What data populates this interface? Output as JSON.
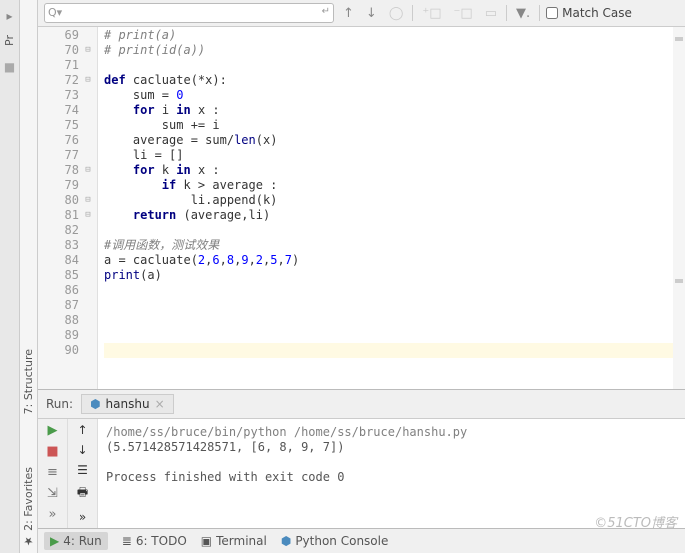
{
  "search": {
    "value": "",
    "placeholder": ""
  },
  "match_case_label": "Match Case",
  "side_tabs": {
    "project": "Pr",
    "structure": "7: Structure",
    "favorites": "2: Favorites"
  },
  "gutter": {
    "start": 69,
    "end": 90
  },
  "code_lines": [
    {
      "n": 69,
      "indent": 0,
      "segs": [
        {
          "t": "# print(a)",
          "c": "cm"
        }
      ]
    },
    {
      "n": 70,
      "indent": 0,
      "segs": [
        {
          "t": "# print(id(a))",
          "c": "cm"
        }
      ],
      "fold": "-"
    },
    {
      "n": 71,
      "indent": 0,
      "segs": []
    },
    {
      "n": 72,
      "indent": 0,
      "segs": [
        {
          "t": "def ",
          "c": "kw"
        },
        {
          "t": "cacluate(*x):",
          "c": ""
        }
      ],
      "fold": "-"
    },
    {
      "n": 73,
      "indent": 1,
      "segs": [
        {
          "t": "sum = ",
          "c": ""
        },
        {
          "t": "0",
          "c": "num"
        }
      ]
    },
    {
      "n": 74,
      "indent": 1,
      "segs": [
        {
          "t": "for ",
          "c": "kw"
        },
        {
          "t": "i ",
          "c": ""
        },
        {
          "t": "in ",
          "c": "kw"
        },
        {
          "t": "x :",
          "c": ""
        }
      ]
    },
    {
      "n": 75,
      "indent": 2,
      "segs": [
        {
          "t": "sum += i",
          "c": ""
        }
      ],
      "arrow": true
    },
    {
      "n": 76,
      "indent": 1,
      "segs": [
        {
          "t": "average = sum/",
          "c": ""
        },
        {
          "t": "len",
          "c": "builtin"
        },
        {
          "t": "(x)",
          "c": ""
        }
      ]
    },
    {
      "n": 77,
      "indent": 1,
      "segs": [
        {
          "t": "li = []",
          "c": ""
        }
      ]
    },
    {
      "n": 78,
      "indent": 1,
      "segs": [
        {
          "t": "for ",
          "c": "kw"
        },
        {
          "t": "k ",
          "c": ""
        },
        {
          "t": "in ",
          "c": "kw"
        },
        {
          "t": "x :",
          "c": ""
        }
      ],
      "fold": "-"
    },
    {
      "n": 79,
      "indent": 2,
      "segs": [
        {
          "t": "if ",
          "c": "kw"
        },
        {
          "t": "k > average :",
          "c": ""
        }
      ]
    },
    {
      "n": 80,
      "indent": 3,
      "segs": [
        {
          "t": "li.append(k)",
          "c": ""
        }
      ],
      "fold": "-"
    },
    {
      "n": 81,
      "indent": 1,
      "segs": [
        {
          "t": "return ",
          "c": "kw"
        },
        {
          "t": "(average,li)",
          "c": ""
        }
      ],
      "fold": "-"
    },
    {
      "n": 82,
      "indent": 0,
      "segs": []
    },
    {
      "n": 83,
      "indent": 0,
      "segs": [
        {
          "t": "#调用函数，测试效果",
          "c": "cm"
        }
      ]
    },
    {
      "n": 84,
      "indent": 0,
      "segs": [
        {
          "t": "a = cacluate(",
          "c": ""
        },
        {
          "t": "2",
          "c": "num"
        },
        {
          "t": ",",
          "c": ""
        },
        {
          "t": "6",
          "c": "num"
        },
        {
          "t": ",",
          "c": ""
        },
        {
          "t": "8",
          "c": "num"
        },
        {
          "t": ",",
          "c": ""
        },
        {
          "t": "9",
          "c": "num"
        },
        {
          "t": ",",
          "c": ""
        },
        {
          "t": "2",
          "c": "num"
        },
        {
          "t": ",",
          "c": ""
        },
        {
          "t": "5",
          "c": "num"
        },
        {
          "t": ",",
          "c": ""
        },
        {
          "t": "7",
          "c": "num"
        },
        {
          "t": ")",
          "c": ""
        }
      ]
    },
    {
      "n": 85,
      "indent": 0,
      "segs": [
        {
          "t": "print",
          "c": "builtin"
        },
        {
          "t": "(a)",
          "c": ""
        }
      ]
    },
    {
      "n": 86,
      "indent": 0,
      "segs": []
    },
    {
      "n": 87,
      "indent": 0,
      "segs": []
    },
    {
      "n": 88,
      "indent": 0,
      "segs": []
    },
    {
      "n": 89,
      "indent": 0,
      "segs": []
    },
    {
      "n": 90,
      "indent": 0,
      "segs": [],
      "caret": true
    }
  ],
  "run": {
    "label": "Run:",
    "tab_name": "hanshu",
    "output": [
      {
        "t": "/home/ss/bruce/bin/python /home/ss/bruce/hanshu.py",
        "c": "cmd-line"
      },
      {
        "t": "(5.571428571428571, [6, 8, 9, 7])",
        "c": ""
      },
      {
        "t": "",
        "c": ""
      },
      {
        "t": "Process finished with exit code 0",
        "c": ""
      }
    ]
  },
  "bottom": {
    "run": "4: Run",
    "todo": "6: TODO",
    "terminal": "Terminal",
    "python_console": "Python Console"
  },
  "watermark": "©51CTO博客"
}
